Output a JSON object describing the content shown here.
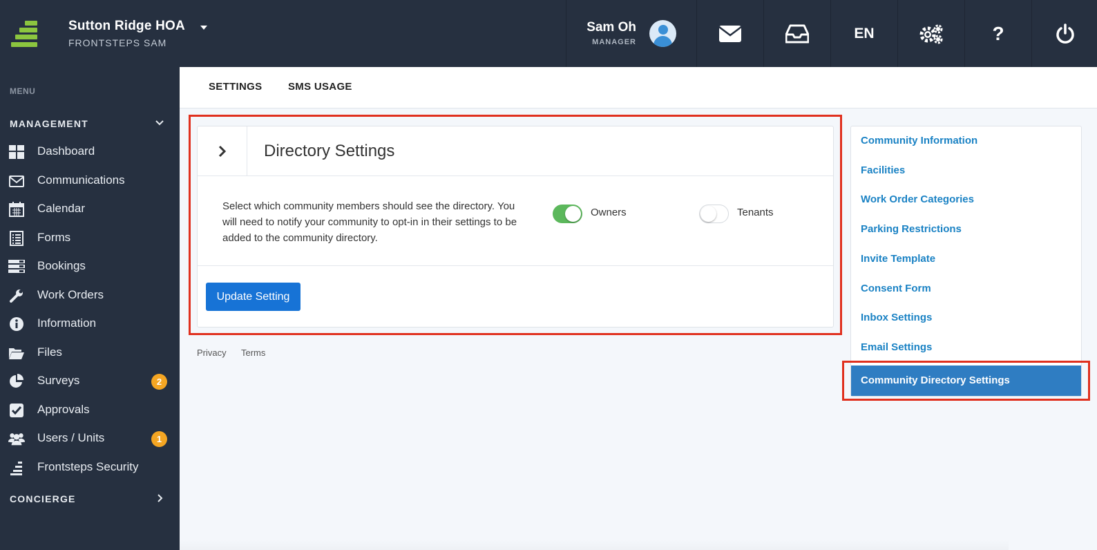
{
  "header": {
    "org_name": "Sutton Ridge HOA",
    "org_sub": "FRONTSTEPS SAM",
    "user_name": "Sam Oh",
    "user_role": "MANAGER",
    "language": "EN",
    "help_glyph": "?"
  },
  "sidebar": {
    "menu_label": "MENU",
    "management_label": "MANAGEMENT",
    "concierge_label": "CONCIERGE",
    "items": [
      {
        "label": "Dashboard",
        "icon": "dashboard-icon"
      },
      {
        "label": "Communications",
        "icon": "envelope-icon"
      },
      {
        "label": "Calendar",
        "icon": "calendar-icon"
      },
      {
        "label": "Forms",
        "icon": "forms-icon"
      },
      {
        "label": "Bookings",
        "icon": "bookings-icon"
      },
      {
        "label": "Work Orders",
        "icon": "wrench-icon"
      },
      {
        "label": "Information",
        "icon": "info-icon"
      },
      {
        "label": "Files",
        "icon": "folder-icon"
      },
      {
        "label": "Surveys",
        "icon": "pie-chart-icon",
        "badge": "2"
      },
      {
        "label": "Approvals",
        "icon": "checkbox-icon"
      },
      {
        "label": "Users / Units",
        "icon": "users-icon",
        "badge": "1"
      },
      {
        "label": "Frontsteps Security",
        "icon": "frontsteps-icon"
      }
    ]
  },
  "tabs": {
    "settings": "SETTINGS",
    "sms_usage": "SMS USAGE"
  },
  "card": {
    "title": "Directory Settings",
    "description": "Select which community members should see the directory. You will need to notify your community to opt-in in their settings to be added to the community directory.",
    "owners_label": "Owners",
    "owners_enabled": true,
    "tenants_label": "Tenants",
    "tenants_enabled": false,
    "update_button": "Update Setting"
  },
  "footer": {
    "privacy": "Privacy",
    "terms": "Terms"
  },
  "side_nav": {
    "links": [
      "Community Information",
      "Facilities",
      "Work Order Categories",
      "Parking Restrictions",
      "Invite Template",
      "Consent Form",
      "Inbox Settings",
      "Email Settings"
    ],
    "active": "Community Directory Settings"
  },
  "colors": {
    "topbar": "#263040",
    "accent_green": "#8cc63f",
    "link_blue": "#1a82c4",
    "active_blue": "#2f7dc2",
    "button_blue": "#1773d6",
    "highlight_red": "#e0301e",
    "badge_orange": "#f5a623"
  }
}
